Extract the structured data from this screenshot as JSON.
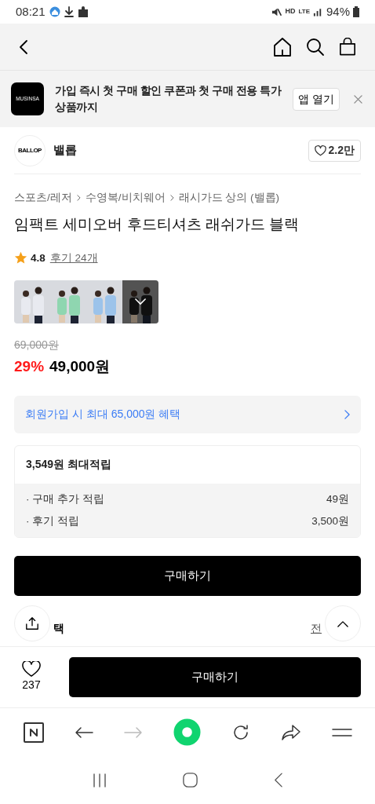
{
  "status_bar": {
    "time": "08:21",
    "network": "HD",
    "lte": "LTE",
    "battery": "94%"
  },
  "app_banner": {
    "logo": "MUSINSA",
    "text": "가입 즉시 첫 구매 할인 쿠폰과 첫 구매 전용 특가 상품까지",
    "button": "앱 열기"
  },
  "brand": {
    "logo": "BALLOP",
    "name": "밸롭",
    "likes": "2.2만"
  },
  "breadcrumb": [
    "스포츠/레저",
    "수영복/비치웨어",
    "래시가드 상의 (밸롭)"
  ],
  "product": {
    "title": "임팩트 세미오버 후드티셔츠 래쉬가드 블랙",
    "rating": "4.8",
    "reviews": "후기 24개"
  },
  "thumbnails": [
    {
      "color": "#e8eaf0",
      "selected": false
    },
    {
      "color": "#8fd6b0",
      "selected": false
    },
    {
      "color": "#9cc3ea",
      "selected": false
    },
    {
      "color": "#1c1c1c",
      "selected": true
    }
  ],
  "price": {
    "original": "69,000원",
    "discount": "29%",
    "current": "49,000원"
  },
  "member_benefit": "회원가입 시 최대 65,000원 혜택",
  "points": {
    "title": "3,549원 최대적립",
    "rows": [
      {
        "label": "· 구매 추가 적립",
        "value": "49원"
      },
      {
        "label": "· 후기 적립",
        "value": "3,500원"
      }
    ]
  },
  "buy_button": "구매하기",
  "partial_row": {
    "left": "택",
    "right": "전"
  },
  "bottom_bar": {
    "likes": "237",
    "button": "구매하기"
  }
}
